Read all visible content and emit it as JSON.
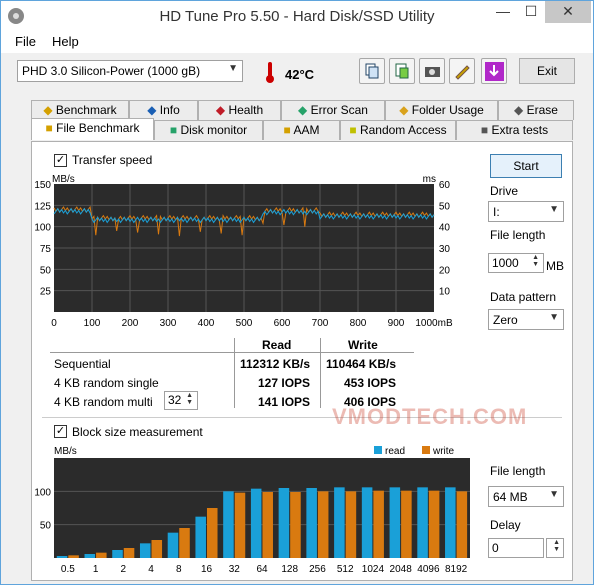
{
  "window": {
    "title": "HD Tune Pro 5.50 - Hard Disk/SSD Utility",
    "min": "—",
    "max": "☐",
    "close": "✕"
  },
  "menu": {
    "file": "File",
    "help": "Help"
  },
  "toolbar": {
    "drive": "PHD 3.0 Silicon-Power (1000 gB)",
    "temp": "42°C",
    "exit": "Exit"
  },
  "tabs_top": [
    "Benchmark",
    "Info",
    "Health",
    "Error Scan",
    "Folder Usage",
    "Erase"
  ],
  "tabs_bottom": [
    "File Benchmark",
    "Disk monitor",
    "AAM",
    "Random Access",
    "Extra tests"
  ],
  "transfer": {
    "checkbox_label": "Transfer speed",
    "y_unit": "MB/s",
    "y2_unit": "ms",
    "y_ticks": [
      "150",
      "125",
      "100",
      "75",
      "50",
      "25"
    ],
    "y2_ticks": [
      "60",
      "50",
      "40",
      "30",
      "20",
      "10"
    ],
    "x_ticks": [
      "0",
      "100",
      "200",
      "300",
      "400",
      "500",
      "600",
      "700",
      "800",
      "900",
      "1000mB"
    ]
  },
  "results": {
    "read_header": "Read",
    "write_header": "Write",
    "rows": [
      {
        "label": "Sequential",
        "read": "112312 KB/s",
        "write": "110464 KB/s"
      },
      {
        "label": "4 KB random single",
        "read": "127 IOPS",
        "write": "453 IOPS"
      },
      {
        "label": "4 KB random multi",
        "read": "141 IOPS",
        "write": "406 IOPS"
      }
    ],
    "multi_value": "32"
  },
  "side": {
    "start": "Start",
    "drive_label": "Drive",
    "drive_value": "I:",
    "file_length_label": "File length",
    "file_length_value": "1000",
    "mb": "MB",
    "pattern_label": "Data pattern",
    "pattern_value": "Zero"
  },
  "block": {
    "checkbox_label": "Block size measurement",
    "y_unit": "MB/s",
    "legend_read": "read",
    "legend_write": "write",
    "y_ticks": [
      "100",
      "50"
    ],
    "file_length_label": "File length",
    "file_length_value": "64 MB",
    "delay_label": "Delay",
    "delay_value": "0"
  },
  "watermark": "VMODTECH.COM",
  "chart_data": {
    "type": "bar",
    "categories": [
      "0.5",
      "1",
      "2",
      "4",
      "8",
      "16",
      "32",
      "64",
      "128",
      "256",
      "512",
      "1024",
      "2048",
      "4096",
      "8192"
    ],
    "ylim": [
      0,
      150
    ],
    "series": [
      {
        "name": "read",
        "values": [
          3,
          6,
          12,
          22,
          38,
          62,
          100,
          104,
          105,
          105,
          106,
          106,
          106,
          106,
          106
        ]
      },
      {
        "name": "write",
        "values": [
          4,
          8,
          15,
          27,
          45,
          75,
          98,
          99,
          99,
          100,
          100,
          101,
          101,
          101,
          100
        ]
      }
    ],
    "colors": {
      "read": "#1aa0d8",
      "write": "#d97a10"
    }
  }
}
